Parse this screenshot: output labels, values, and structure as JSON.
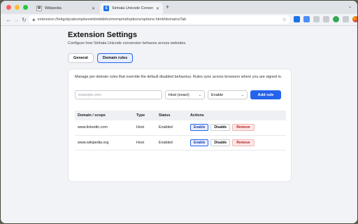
{
  "browser": {
    "tabs": [
      {
        "title": "Wikipedia",
        "favicon": "W"
      },
      {
        "title": "Sinhala Unicode Converter – O",
        "favicon": "S"
      }
    ],
    "url": "extension://lekgckjcabompbeeimbmbkbhcimnmpmd/options/options.html#domainsTab"
  },
  "page": {
    "title": "Extension Settings",
    "subtitle": "Configure how Sinhala Unicode conversion behaves across websites.",
    "tabs": [
      {
        "label": "General",
        "active": false
      },
      {
        "label": "Domain rules",
        "active": true
      }
    ],
    "description": "Manage per-domain rules that override the default disabled behaviour. Rules sync across browsers where you are signed in.",
    "form": {
      "domain_placeholder": "example.com",
      "type_selected": "Host (exact)",
      "action_selected": "Enable",
      "add_label": "Add rule"
    },
    "table": {
      "headers": [
        "Domain / scope",
        "Type",
        "Status",
        "Actions"
      ],
      "rows": [
        {
          "domain": "www.linkedin.com",
          "type": "Host",
          "status": "Enabled"
        },
        {
          "domain": "www.wikipedia.org",
          "type": "Host",
          "status": "Enabled"
        }
      ],
      "action_labels": {
        "enable": "Enable",
        "disable": "Disable",
        "remove": "Remove"
      }
    }
  },
  "colors": {
    "accent": "#2563eb",
    "remove": "#b91c1c"
  }
}
